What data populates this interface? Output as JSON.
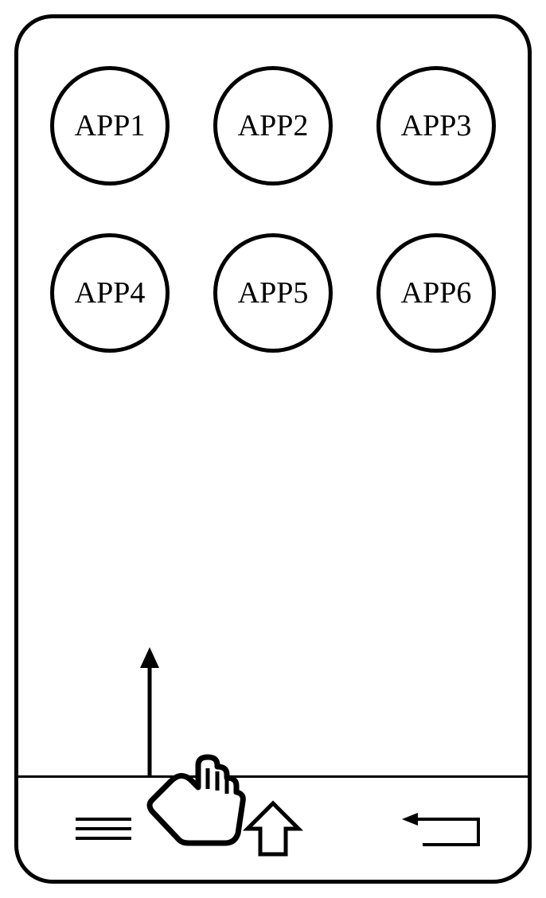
{
  "apps": {
    "a1": "APP1",
    "a2": "APP2",
    "a3": "APP3",
    "a4": "APP4",
    "a5": "APP5",
    "a6": "APP6"
  },
  "gesture": {
    "direction": "up"
  },
  "nav": {
    "menu": "menu",
    "home": "home",
    "back": "back"
  }
}
